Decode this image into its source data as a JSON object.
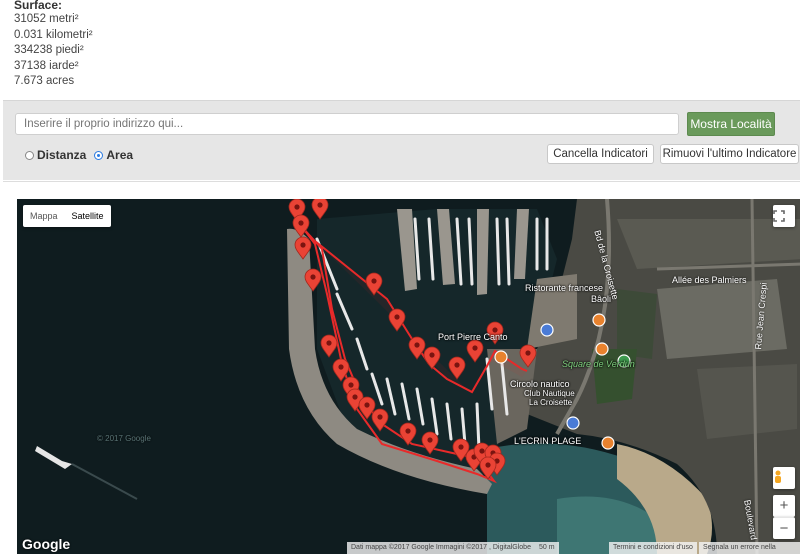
{
  "results": {
    "title": "Surface:",
    "lines": [
      "31052 metri²",
      "0.031 kilometri²",
      "334238 piedi²",
      "37138 iarde²",
      "7.673 acres"
    ]
  },
  "controls": {
    "address_placeholder": "Inserire il proprio indirizzo qui...",
    "show_button": "Mostra Località",
    "radio_distance": "Distanza",
    "radio_area": "Area",
    "clear_button": "Cancella Indicatori",
    "remove_last_button": "Rimuovi l'ultimo Indicatore"
  },
  "map": {
    "type_map": "Mappa",
    "type_satellite": "Satellite",
    "logo": "Google",
    "attribution": "Dati mappa ©2017 Google Immagini ©2017 , DigitalGlobe",
    "scale": "50 m",
    "terms": "Termini e condizioni d'uso",
    "report": "Segnala un errore nella mappa",
    "labels": {
      "port": "Port Pierre Canto",
      "restaurant": "Ristorante francese",
      "restaurant_name": "Bâoli",
      "square": "Square de Verdun",
      "club": "Circolo nautico",
      "club_name1": "Club Nautique",
      "club_name2": "La Croisette",
      "beach": "L'ECRIN PLAGE",
      "allee": "Allée des Palmiers",
      "croisette": "Bd de la Croisette",
      "jean_crespi": "Rue Jean Crespi",
      "boulevard": "Boulevard",
      "copyright": "© 2017 Google"
    },
    "fullscreen_icon": "fullscreen-icon",
    "pegman_icon": "pegman-icon",
    "marker_icon": "map-marker-icon"
  }
}
